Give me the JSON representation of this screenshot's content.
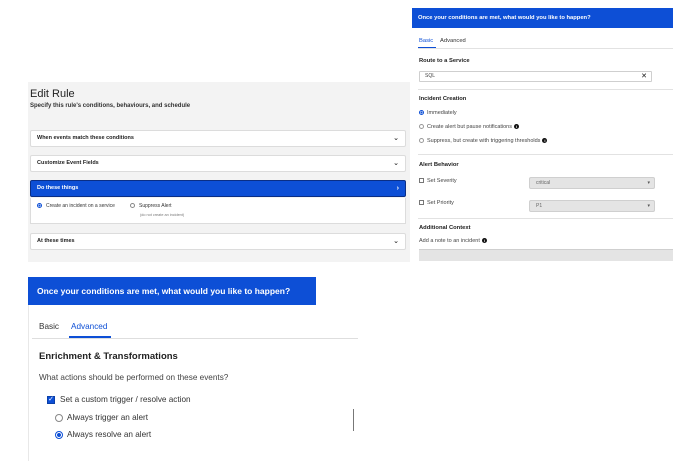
{
  "edit_rule": {
    "title": "Edit Rule",
    "subtitle": "Specify this rule's conditions, behaviours, and schedule",
    "sections": [
      {
        "label": "When events match these conditions"
      },
      {
        "label": "Customize Event Fields"
      },
      {
        "label": "Do these things"
      },
      {
        "label": "At these times"
      }
    ],
    "do_things_options": {
      "option1": "Create an incident on a service",
      "option2": "Suppress Alert",
      "option2_hint": "(do not create an incident)"
    }
  },
  "right_panel": {
    "header": "Once your conditions are met, what would you like to happen?",
    "tabs": [
      "Basic",
      "Advanced"
    ],
    "route_heading": "Route to a Service",
    "route_value": "SQL",
    "incident_heading": "Incident Creation",
    "incident_options": [
      "Immediately",
      "Create alert but pause notifications",
      "Suppress, but create with triggering thresholds"
    ],
    "alert_heading": "Alert Behavior",
    "severity_label": "Set Severity",
    "severity_value": "critical",
    "priority_label": "Set Priority",
    "priority_value": "P1",
    "context_heading": "Additional Context",
    "note_label": "Add a note to an incident"
  },
  "bottom_panel": {
    "header": "Once your conditions are met, what would you like to happen?",
    "tabs": [
      "Basic",
      "Advanced"
    ],
    "heading": "Enrichment & Transformations",
    "question": "What actions should be performed on these events?",
    "checkbox_label": "Set a custom trigger / resolve action",
    "radio_options": [
      "Always trigger an alert",
      "Always resolve an alert"
    ]
  },
  "colors": {
    "primary_blue": "#0d4fd6",
    "panel_gray": "#f3f3f3"
  },
  "icons": {
    "collapse": "chevron-down-icon",
    "expand": "chevron-right-icon",
    "clear": "close-icon",
    "info": "info-icon"
  }
}
